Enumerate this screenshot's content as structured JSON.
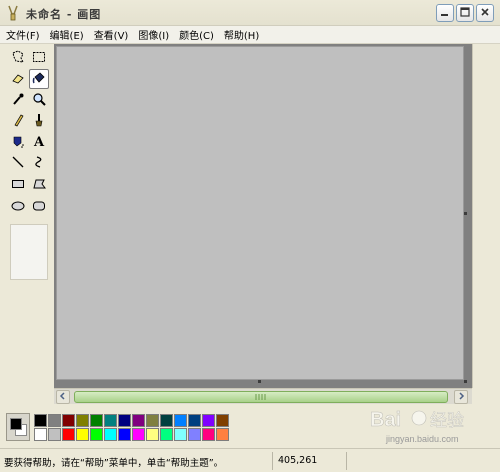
{
  "window": {
    "title": "未命名 - 画图",
    "app_icon": "paint-brush-icon",
    "controls": [
      "minimize-icon",
      "maximize-icon",
      "close-icon"
    ]
  },
  "menu": {
    "items": [
      "文件(F)",
      "编辑(E)",
      "查看(V)",
      "图像(I)",
      "颜色(C)",
      "帮助(H)"
    ]
  },
  "toolbox": {
    "tools": [
      "free-form-select-icon",
      "rect-select-icon",
      "eraser-icon",
      "fill-bucket-icon",
      "color-picker-icon",
      "magnifier-icon",
      "pencil-icon",
      "brush-icon",
      "airbrush-icon",
      "text-icon",
      "line-icon",
      "curve-icon",
      "rectangle-icon",
      "polygon-icon",
      "ellipse-icon",
      "rounded-rectangle-icon"
    ],
    "active_tool": "fill-bucket-icon"
  },
  "palette": {
    "foreground": "#000000",
    "background": "#ffffff",
    "row1": [
      "#000000",
      "#808080",
      "#800000",
      "#808000",
      "#008000",
      "#008080",
      "#000080",
      "#800080",
      "#808040",
      "#004040",
      "#0080ff",
      "#004080",
      "#8000ff",
      "#804000"
    ],
    "row2": [
      "#ffffff",
      "#c0c0c0",
      "#ff0000",
      "#ffff00",
      "#00ff00",
      "#00ffff",
      "#0000ff",
      "#ff00ff",
      "#ffff80",
      "#00ff80",
      "#80ffff",
      "#8080ff",
      "#ff0080",
      "#ff8040"
    ]
  },
  "status": {
    "help_text": "要获得帮助，请在“帮助”菜单中，单击“帮助主题”。",
    "coords": "405,261"
  },
  "watermark": {
    "logo": "Bai 经验",
    "url": "jingyan.baidu.com"
  },
  "colors": {
    "canvas": "#bfbfbf",
    "workspace": "#808080",
    "chrome": "#ece9d8"
  }
}
